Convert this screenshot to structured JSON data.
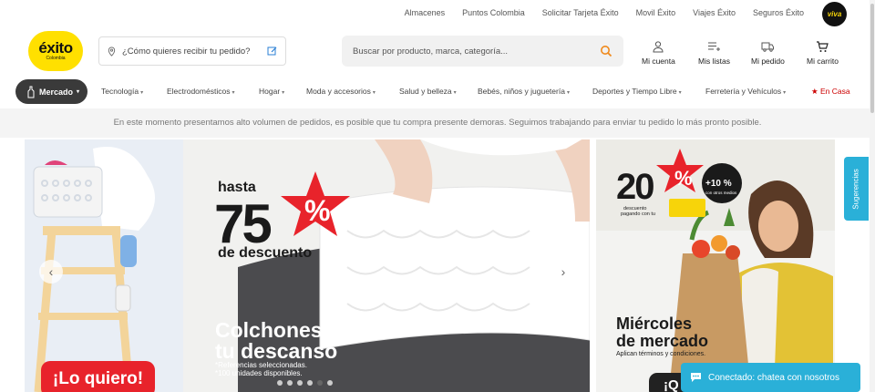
{
  "top_links": [
    "Almacenes",
    "Puntos Colombia",
    "Solicitar Tarjeta Éxito",
    "Movil Éxito",
    "Viajes Éxito",
    "Seguros Éxito"
  ],
  "viva_label": "viva",
  "logo": {
    "name": "éxito",
    "sub": "Colombia",
    "color": "#ffe000"
  },
  "delivery": {
    "text": "¿Cómo quieres recibir tu pedido?"
  },
  "search": {
    "placeholder": "Buscar por producto, marca, categoría..."
  },
  "account": [
    {
      "label": "Mi cuenta",
      "icon": "user-icon"
    },
    {
      "label": "Mis listas",
      "icon": "list-icon"
    },
    {
      "label": "Mi pedido",
      "icon": "truck-icon"
    },
    {
      "label": "Mi carrito",
      "icon": "cart-icon"
    }
  ],
  "nav": {
    "active": "Mercado",
    "items": [
      "Tecnología",
      "Electrodomésticos",
      "Hogar",
      "Moda y accesorios",
      "Salud y belleza",
      "Bebés, niños y juguetería",
      "Deportes y Tiempo Libre",
      "Ferretería y Vehículos"
    ],
    "special": "En Casa"
  },
  "notice": "En este momento presentamos alto volumen de pedidos, es posible que tu compra presente demoras. Seguimos trabajando para enviar tu pedido lo más pronto posible.",
  "banner_left": {
    "cta": "¡Lo quiero!"
  },
  "banner_main": {
    "pre": "hasta",
    "discount": "75",
    "percent": "%",
    "post": "de descuento",
    "title1": "Colchones para",
    "title2": "tu descanso",
    "note1": "*Referencias seleccionadas.",
    "note2": "*100 unidades disponibles."
  },
  "banner_right": {
    "discount": "20",
    "percent": "%",
    "extra": "+10 %",
    "extra_sub": "con otros medios",
    "small1": "descuento",
    "small2": "pagando con tu",
    "title1": "Miércoles",
    "title2": "de mercado",
    "terms": "Aplican términos y condiciones.",
    "cta": "¡Q"
  },
  "carousel": {
    "dots": 6,
    "active": 4
  },
  "side_tab": "Sugerencias",
  "chat": "Conectado: chatea con nosotros",
  "colors": {
    "accent": "#ffe000",
    "star": "#e8232b",
    "chat": "#2ab0d8",
    "nav_active": "#3a3a3a"
  }
}
